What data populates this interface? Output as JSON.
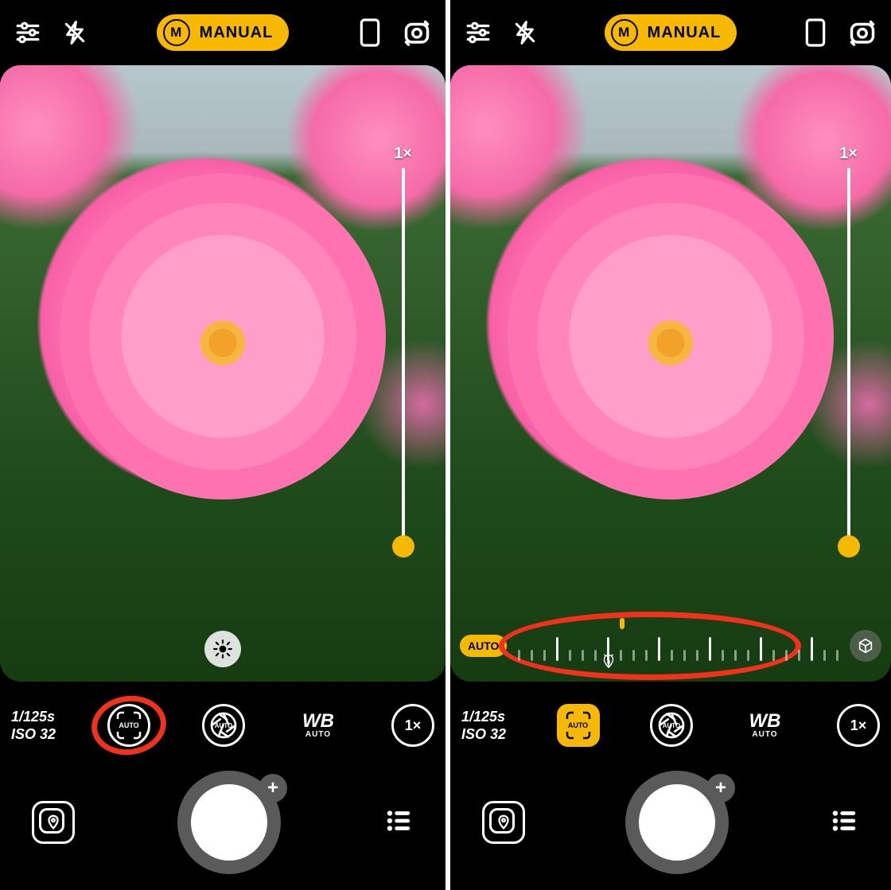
{
  "app": "camera",
  "panels": [
    {
      "mode_badge_letter": "M",
      "mode_label": "MANUAL",
      "zoom_label": "1×",
      "brightness_visible": true,
      "focus_slider_visible": false,
      "exposure_shutter": "1/125s",
      "exposure_iso": "ISO 32",
      "focus_btn_label": "AUTO",
      "focus_btn_active": false,
      "aperture_btn_label": "AUTO",
      "wb_label": "WB",
      "wb_sub": "AUTO",
      "lens_label": "1×",
      "highlight": "focus-button",
      "shutter_plus": "+"
    },
    {
      "mode_badge_letter": "M",
      "mode_label": "MANUAL",
      "zoom_label": "1×",
      "brightness_visible": false,
      "focus_slider_visible": true,
      "focus_auto_chip": "AUTO",
      "exposure_shutter": "1/125s",
      "exposure_iso": "ISO 32",
      "focus_btn_label": "AUTO",
      "focus_btn_active": true,
      "aperture_btn_label": "AUTO",
      "wb_label": "WB",
      "wb_sub": "AUTO",
      "lens_label": "1×",
      "highlight": "focus-slider",
      "shutter_plus": "+"
    }
  ]
}
